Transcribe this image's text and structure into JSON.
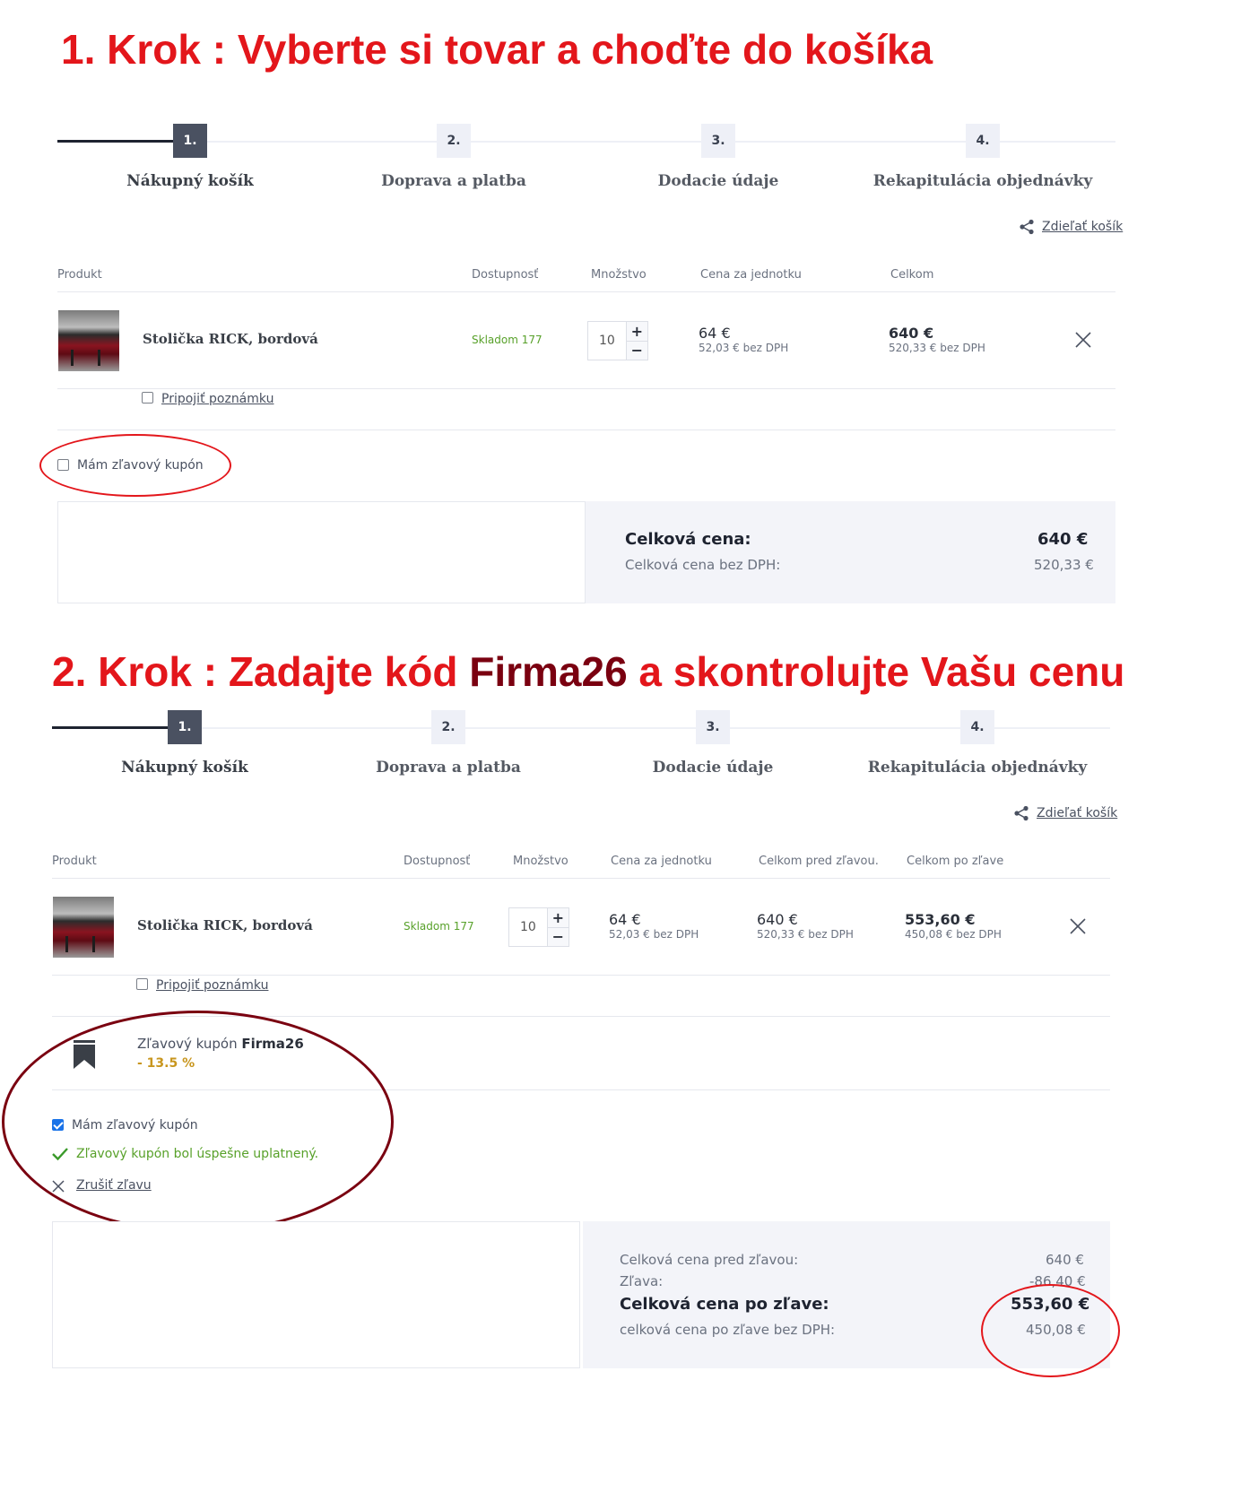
{
  "step1": {
    "heading": "1. Krok : Vyberte si tovar a choďte do košíka",
    "progress": [
      {
        "num": "1.",
        "label": "Nákupný košík"
      },
      {
        "num": "2.",
        "label": "Doprava a platba"
      },
      {
        "num": "3.",
        "label": "Dodacie údaje"
      },
      {
        "num": "4.",
        "label": "Rekapitulácia objednávky"
      }
    ],
    "share_label": "Zdieľať košík",
    "columns": [
      "Produkt",
      "Dostupnosť",
      "Množstvo",
      "Cena za jednotku",
      "Celkom"
    ],
    "item": {
      "name": "Stolička RICK, bordová",
      "stock": "Skladom 177",
      "qty": "10",
      "unit_price": "64 €",
      "unit_price_net": "52,03 € bez DPH",
      "total": "640 €",
      "total_net": "520,33 € bez DPH"
    },
    "note_link": "Pripojiť poznámku",
    "coupon_checkbox": "Mám zľavový kupón",
    "summary": {
      "total_label": "Celková cena:",
      "total_value": "640 €",
      "net_label": "Celková cena bez DPH:",
      "net_value": "520,33 €"
    }
  },
  "step2": {
    "heading_prefix": "2. Krok : Zadajte kód ",
    "heading_code": "Firma26",
    "heading_suffix": " a skontrolujte Vašu cenu",
    "progress": [
      {
        "num": "1.",
        "label": "Nákupný košík"
      },
      {
        "num": "2.",
        "label": "Doprava a platba"
      },
      {
        "num": "3.",
        "label": "Dodacie údaje"
      },
      {
        "num": "4.",
        "label": "Rekapitulácia objednávky"
      }
    ],
    "share_label": "Zdieľať košík",
    "columns": [
      "Produkt",
      "Dostupnosť",
      "Množstvo",
      "Cena za jednotku",
      "Celkom pred zľavou.",
      "Celkom po zľave"
    ],
    "item": {
      "name": "Stolička RICK, bordová",
      "stock": "Skladom 177",
      "qty": "10",
      "unit_price": "64 €",
      "unit_price_net": "52,03 € bez DPH",
      "total_before": "640 €",
      "total_before_net": "520,33 € bez DPH",
      "total_after": "553,60 €",
      "total_after_net": "450,08 € bez DPH"
    },
    "note_link": "Pripojiť poznámku",
    "coupon": {
      "label": "Zľavový kupón ",
      "code": "Firma26",
      "discount": "- 13.5 %"
    },
    "coupon_checkbox": "Mám zľavový kupón",
    "success_msg": "Zľavový kupón bol úspešne uplatnený.",
    "cancel_link": "Zrušiť zľavu",
    "summary": {
      "before_label": "Celková cena pred zľavou:",
      "before_value": "640 €",
      "discount_label": "Zľava:",
      "discount_value": "-86,40 €",
      "after_label": "Celková cena po zľave:",
      "after_value": "553,60 €",
      "after_net_label": "celková cena po zľave bez DPH:",
      "after_net_value": "450,08 €"
    }
  },
  "colors": {
    "heading_red": "#e3161b",
    "code_dark_red": "#7a0010",
    "ellipse_red": "#e3161b",
    "ellipse_dark": "#7a0010",
    "stock_green": "#58a12a",
    "discount_gold": "#c8961e"
  }
}
